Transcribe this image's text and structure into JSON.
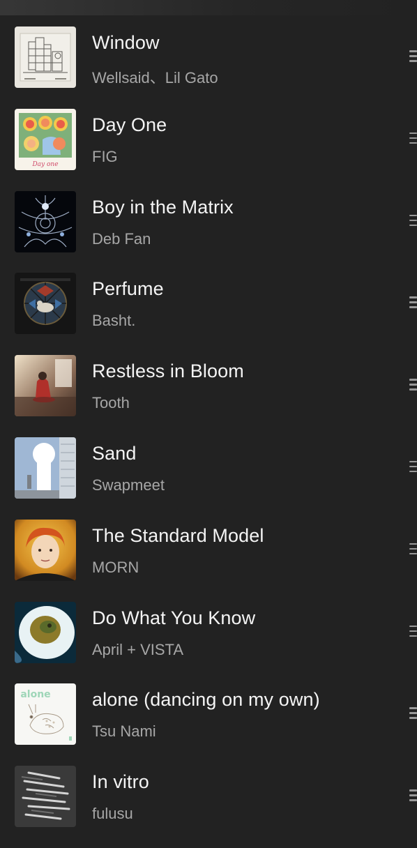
{
  "tracks": [
    {
      "title": "Window",
      "artist": "Wellsaid、Lil Gato",
      "art_icon": "album-art-window"
    },
    {
      "title": "Day One",
      "artist": "FIG",
      "art_icon": "album-art-day-one",
      "art_text": "Day one"
    },
    {
      "title": "Boy in the Matrix",
      "artist": "Deb Fan",
      "art_icon": "album-art-boy-in-the-matrix"
    },
    {
      "title": "Perfume",
      "artist": "Basht.",
      "art_icon": "album-art-perfume"
    },
    {
      "title": "Restless in Bloom",
      "artist": "Tooth",
      "art_icon": "album-art-restless-in-bloom"
    },
    {
      "title": "Sand",
      "artist": "Swapmeet",
      "art_icon": "album-art-sand"
    },
    {
      "title": "The Standard Model",
      "artist": "MORN",
      "art_icon": "album-art-the-standard-model"
    },
    {
      "title": "Do What You Know",
      "artist": "April + VISTA",
      "art_icon": "album-art-do-what-you-know"
    },
    {
      "title": "alone (dancing on my own)",
      "artist": "Tsu Nami",
      "art_icon": "album-art-alone",
      "art_text": "alone"
    },
    {
      "title": "In vitro",
      "artist": "fulusu",
      "art_icon": "album-art-in-vitro"
    }
  ],
  "colors": {
    "background": "#222222",
    "title": "#f4f4f4",
    "artist": "#a7a7a7",
    "handle": "#9a9a9a"
  }
}
